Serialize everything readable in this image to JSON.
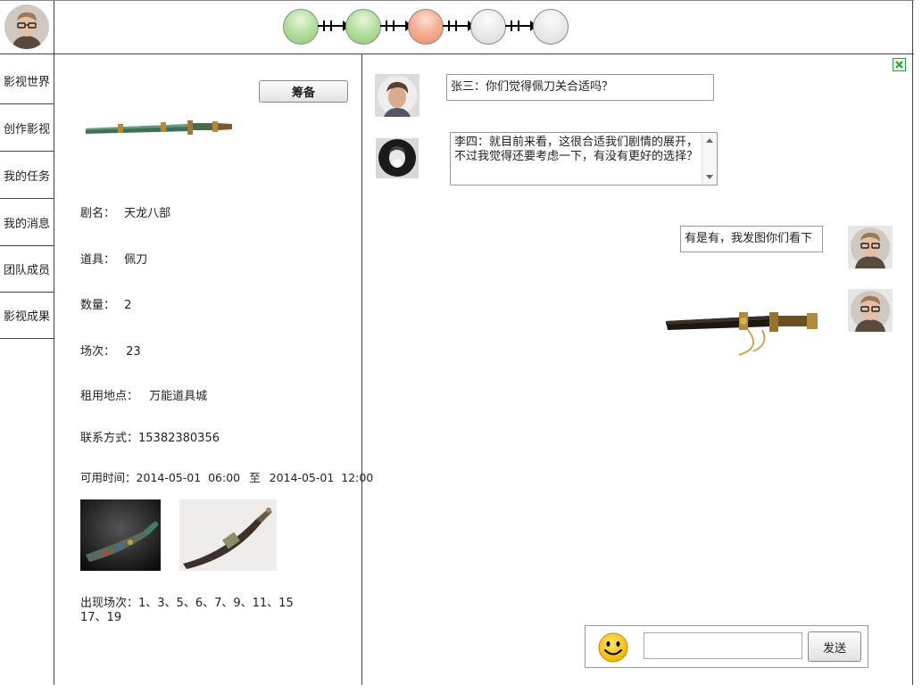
{
  "sidebar": {
    "items": [
      {
        "label": "影视世界"
      },
      {
        "label": "创作影视"
      },
      {
        "label": "我的任务"
      },
      {
        "label": "我的消息"
      },
      {
        "label": "团队成员"
      },
      {
        "label": "影视成果"
      }
    ]
  },
  "stepper": {
    "steps": [
      {
        "status": "done"
      },
      {
        "status": "done"
      },
      {
        "status": "current"
      },
      {
        "status": "todo"
      },
      {
        "status": "todo"
      }
    ]
  },
  "detail": {
    "prepare_button": "筹备",
    "fields": {
      "drama_label": "剧名：",
      "drama_value": "天龙八部",
      "prop_label": "道具：",
      "prop_value": "佩刀",
      "quantity_label": "数量：",
      "quantity_value": "2",
      "scene_label": "场次：",
      "scene_value": "23",
      "location_label": "租用地点：",
      "location_value": "万能道具城",
      "contact_label": "联系方式：",
      "contact_value": "15382380356",
      "available_label": "可用时间：",
      "available_start": "2014-05-01  06:00",
      "available_sep": "至",
      "available_end": "2014-05-01  12:00",
      "appear_label": "出现场次：",
      "appear_value_line1": "1、3、5、6、7、9、11、15",
      "appear_value_line2": "17、19"
    }
  },
  "chat": {
    "messages": [
      {
        "text": "张三：你们觉得佩刀关合适吗？"
      },
      {
        "text": "李四：就目前来看，这很合适我们剧情的展开，不过我觉得还要考虑一下，有没有更好的选择？"
      },
      {
        "text": "有是有，我发图你们看下"
      }
    ],
    "input": {
      "value": "",
      "send_label": "发送"
    }
  },
  "colors": {
    "step_done": "#8ec975",
    "step_current": "#eb8c6a",
    "step_todo": "#e0e0e0",
    "close_icon": "#2ea043"
  }
}
